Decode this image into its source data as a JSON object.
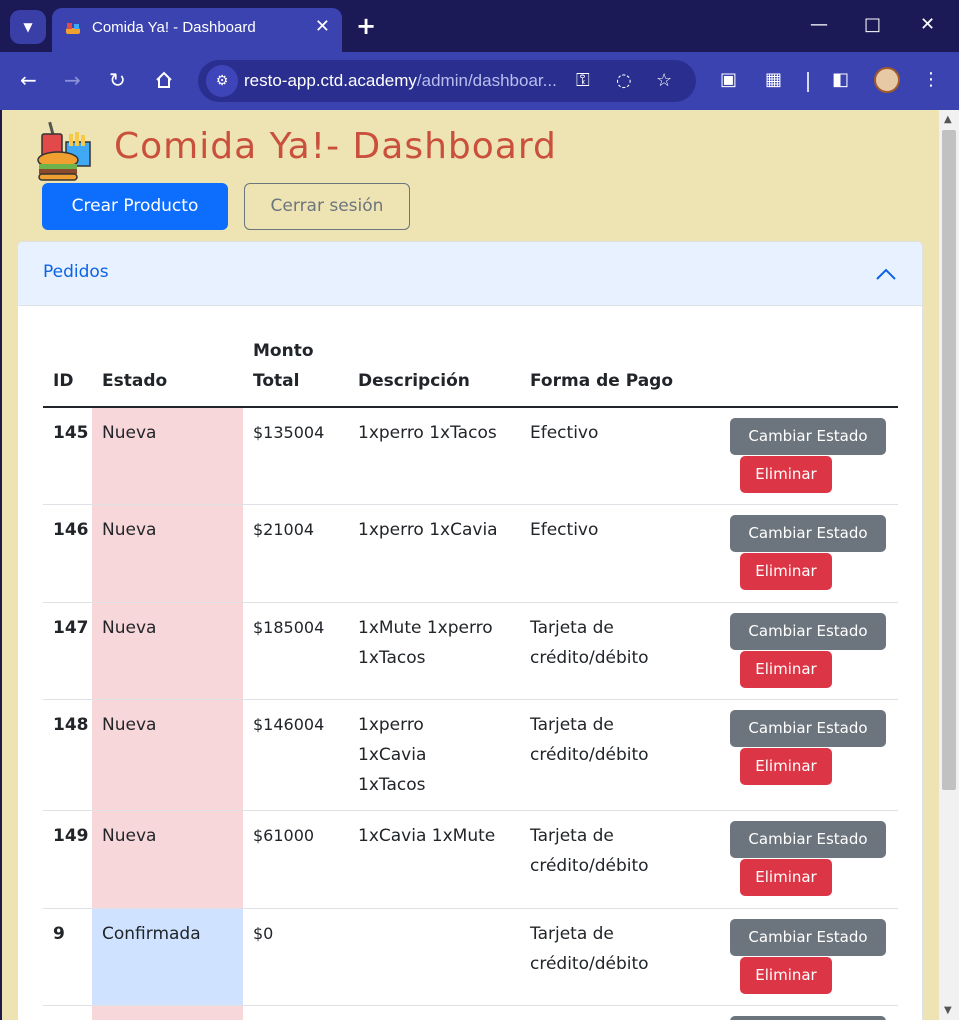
{
  "browser": {
    "tab_title": "Comida Ya! - Dashboard",
    "url_host": "resto-app.ctd.academy",
    "url_path": "/admin/dashboar..."
  },
  "page": {
    "title": "Comida Ya!- Dashboard",
    "create_button": "Crear Producto",
    "logout_button": "Cerrar sesión"
  },
  "accordion": {
    "title": "Pedidos"
  },
  "table": {
    "headers": {
      "id": "ID",
      "estado": "Estado",
      "monto_line1": "Monto",
      "monto_line2": "Total",
      "descripcion": "Descripción",
      "pago": "Forma de Pago"
    },
    "change_label": "Cambiar Estado",
    "delete_label": "Eliminar",
    "rows": [
      {
        "id": "145",
        "estado": "Nueva",
        "monto": "$135004",
        "desc": "1xperro 1xTacos",
        "pago": "Efectivo"
      },
      {
        "id": "146",
        "estado": "Nueva",
        "monto": "$21004",
        "desc": "1xperro 1xCavia",
        "pago": "Efectivo"
      },
      {
        "id": "147",
        "estado": "Nueva",
        "monto": "$185004",
        "desc": "1xMute 1xperro 1xTacos",
        "pago": "Tarjeta de crédito/débito"
      },
      {
        "id": "148",
        "estado": "Nueva",
        "monto": "$146004",
        "desc": "1xperro 1xCavia 1xTacos",
        "pago": "Tarjeta de crédito/débito"
      },
      {
        "id": "149",
        "estado": "Nueva",
        "monto": "$61000",
        "desc": "1xCavia 1xMute",
        "pago": "Tarjeta de crédito/débito"
      },
      {
        "id": "9",
        "estado": "Confirmada",
        "monto": "$0",
        "desc": "",
        "pago": "Tarjeta de crédito/débito"
      }
    ]
  },
  "colors": {
    "page_bg": "#eee3b2",
    "title": "#c9503c",
    "primary": "#0d6efd",
    "danger": "#dc3545",
    "secondary": "#6c757d",
    "estado_nueva": "#f8d7da",
    "estado_confirmada": "#cfe2ff"
  }
}
